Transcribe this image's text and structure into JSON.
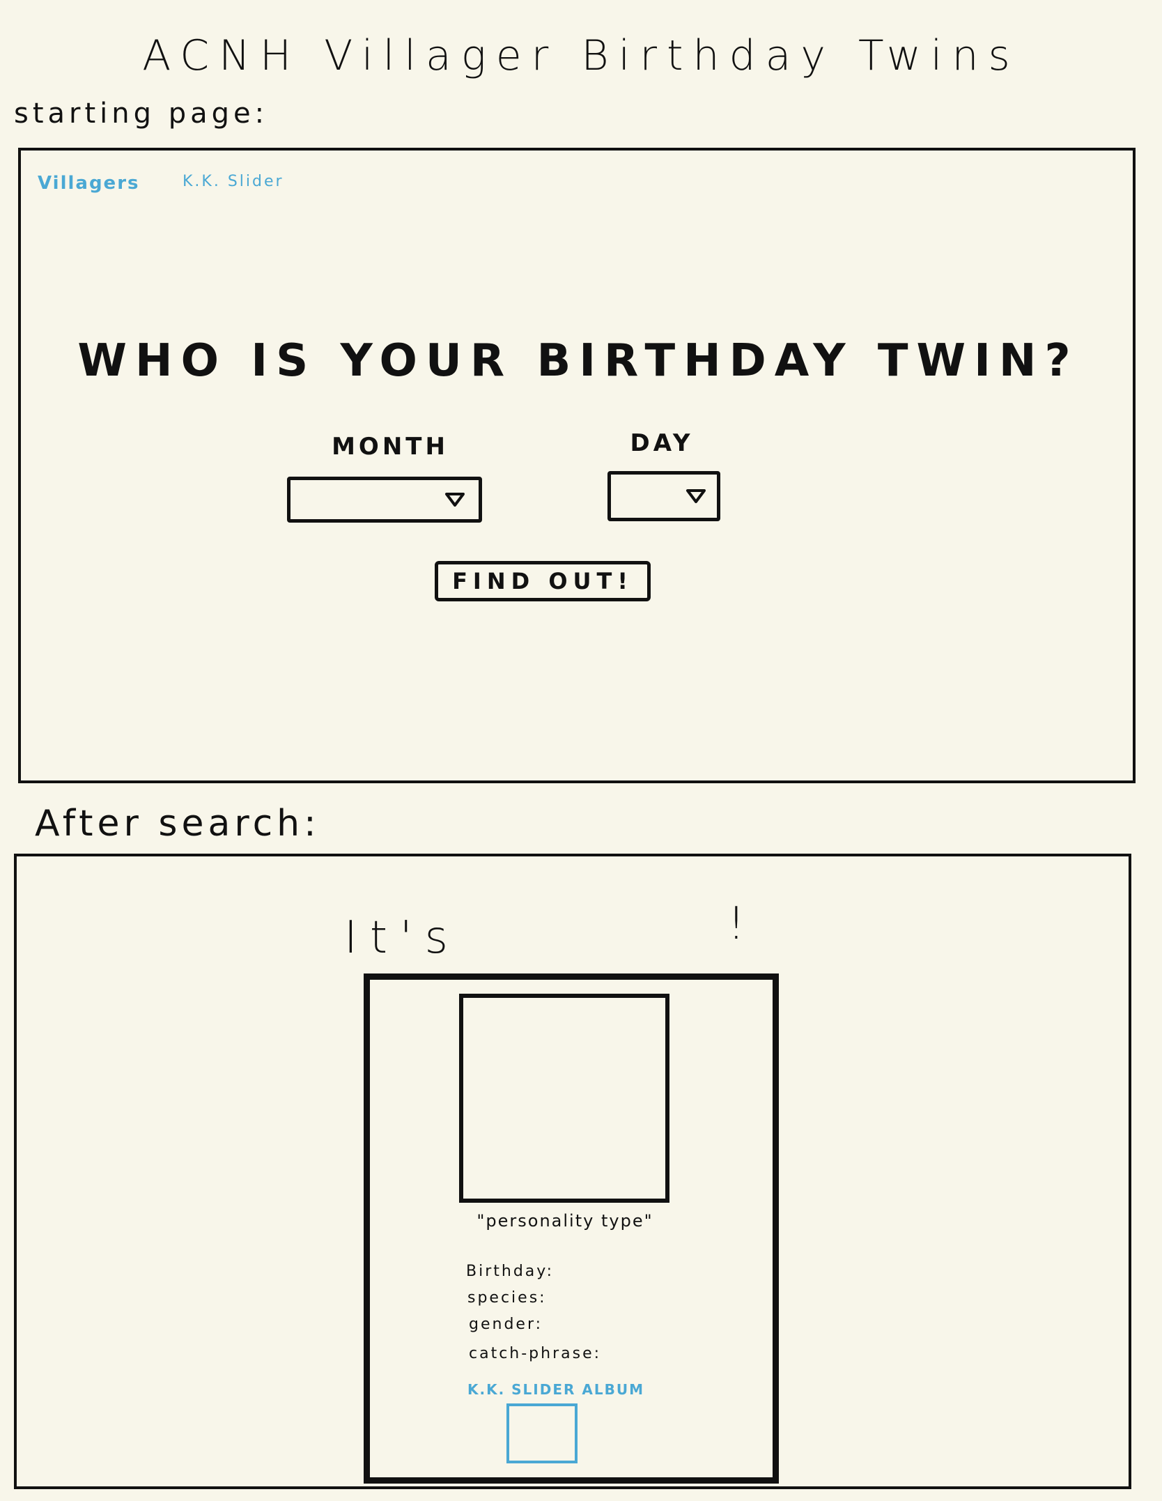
{
  "document": {
    "title": "ACNH Villager Birthday Twins",
    "starting_label": "starting page:",
    "after_label": "After search:"
  },
  "start_page": {
    "nav": {
      "villagers": "Villagers",
      "kk_slider": "K.K. Slider"
    },
    "headline": "WHO IS YOUR BIRTHDAY TWIN?",
    "month_label": "MONTH",
    "day_label": "DAY",
    "month_value": "",
    "day_value": "",
    "button_label": "FIND OUT!",
    "accent_color": "#4aa8d4"
  },
  "result_page": {
    "heading_prefix": "It's",
    "heading_suffix": "!",
    "personality": "\"personality type\"",
    "birthday_label": "Birthday:",
    "species_label": "species:",
    "gender_label": "gender:",
    "catchphrase_label": "catch-phrase:",
    "album_link": "K.K. SLIDER ALBUM"
  }
}
